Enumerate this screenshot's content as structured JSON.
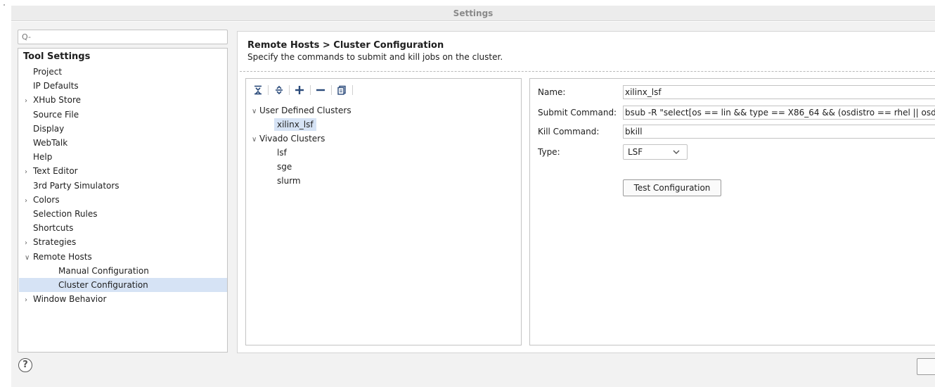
{
  "window": {
    "title": "Settings"
  },
  "search": {
    "placeholder": "Q-"
  },
  "nav": {
    "heading": "Tool Settings",
    "items": [
      {
        "label": "Project",
        "arrow": ""
      },
      {
        "label": "IP Defaults",
        "arrow": ""
      },
      {
        "label": "XHub Store",
        "arrow": ">"
      },
      {
        "label": "Source File",
        "arrow": ""
      },
      {
        "label": "Display",
        "arrow": ""
      },
      {
        "label": "WebTalk",
        "arrow": ""
      },
      {
        "label": "Help",
        "arrow": ""
      },
      {
        "label": "Text Editor",
        "arrow": ">"
      },
      {
        "label": "3rd Party Simulators",
        "arrow": ""
      },
      {
        "label": "Colors",
        "arrow": ">"
      },
      {
        "label": "Selection Rules",
        "arrow": ""
      },
      {
        "label": "Shortcuts",
        "arrow": ""
      },
      {
        "label": "Strategies",
        "arrow": ">"
      },
      {
        "label": "Remote Hosts",
        "arrow": "v"
      },
      {
        "label": "Manual Configuration",
        "arrow": ""
      },
      {
        "label": "Cluster Configuration",
        "arrow": "",
        "selected": true
      },
      {
        "label": "Window Behavior",
        "arrow": ">"
      }
    ]
  },
  "page": {
    "breadcrumb": "Remote Hosts > Cluster Configuration",
    "description": "Specify the commands to submit and kill jobs on the cluster."
  },
  "toolbar": {
    "buttons": [
      {
        "icon": "collapse-all-icon"
      },
      {
        "icon": "expand-all-icon"
      },
      {
        "icon": "plus-icon"
      },
      {
        "icon": "minus-icon"
      },
      {
        "icon": "copy-icon"
      }
    ]
  },
  "tree": {
    "groups": [
      {
        "label": "User Defined Clusters",
        "children": [
          "xilinx_lsf"
        ]
      },
      {
        "label": "Vivado Clusters",
        "children": [
          "lsf",
          "sge",
          "slurm"
        ]
      }
    ],
    "selected": "xilinx_lsf"
  },
  "form": {
    "name_label": "Name:",
    "name_value": "xilinx_lsf",
    "submit_label": "Submit Command:",
    "submit_value": "bsub -R \"select[os == lin && type == X86_64 && (osdistro == rhel || osd",
    "kill_label": "Kill Command:",
    "kill_value": "bkill",
    "type_label": "Type:",
    "type_value": "LSF",
    "test_button": "Test Configuration"
  },
  "footer": {
    "help": "?"
  },
  "colors": {
    "selection": "#d6e3f5",
    "toolbar_icon": "#2a4a7a"
  }
}
